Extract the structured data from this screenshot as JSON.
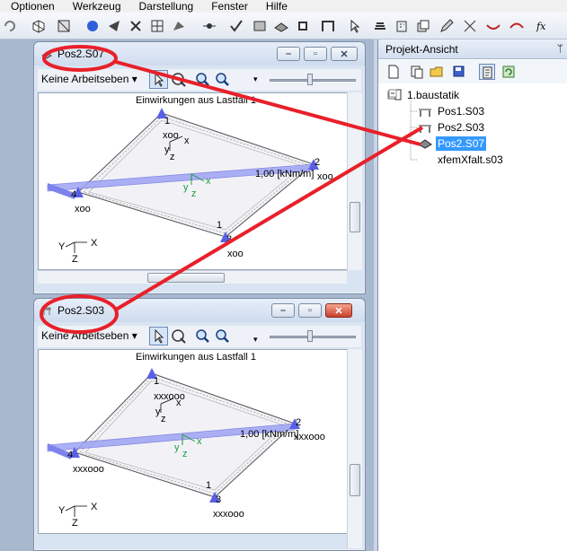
{
  "menu": {
    "items": [
      "Optionen",
      "Werkzeug",
      "Darstellung",
      "Fenster",
      "Hilfe"
    ]
  },
  "windows": [
    {
      "title": "Pos2.S07",
      "ebene_label": "Keine Arbeitseben",
      "view_title": "Einwirkungen aus Lastfall 1",
      "load_label": "1,00 [kNm/m]",
      "node_labels": {
        "top": "xoo",
        "right": "xoo",
        "left": "xoo",
        "bottom": "xoo"
      },
      "node_numbers": {
        "top": "1",
        "right": "2",
        "left": "4",
        "bottom": "1",
        "bottom2": "3"
      },
      "active": false
    },
    {
      "title": "Pos2.S03",
      "ebene_label": "Keine Arbeitseben",
      "view_title": "Einwirkungen aus Lastfall 1",
      "load_label": "1,00 [kNm/m]",
      "node_labels": {
        "top": "xxxooo",
        "right": "xxxooo",
        "left": "xxxooo",
        "bottom": "xxxooo"
      },
      "node_numbers": {
        "top": "1",
        "right": "2",
        "left": "4",
        "bottom": "1",
        "bottom2": "3"
      },
      "active": true
    }
  ],
  "axes": {
    "x": "x",
    "y": "y",
    "z": "z",
    "X": "X",
    "Y": "Y",
    "Z": "Z"
  },
  "panel": {
    "title": "Projekt-Ansicht",
    "pin": "॰",
    "tree": [
      {
        "label": "1.baustatik",
        "icon": "project-icon",
        "level": 0,
        "selected": false
      },
      {
        "label": "Pos1.S03",
        "icon": "table-icon",
        "level": 1,
        "selected": false
      },
      {
        "label": "Pos2.S03",
        "icon": "table-icon",
        "level": 1,
        "selected": false
      },
      {
        "label": "Pos2.S07",
        "icon": "slab-icon",
        "level": 1,
        "selected": true
      },
      {
        "label": "xfemXfalt.s03",
        "icon": "none",
        "level": 1,
        "selected": false
      }
    ]
  },
  "colors": {
    "annotation": "#e8202a",
    "load": "#8a8ff0",
    "support": "#5a5fe6",
    "selection": "#3399ff"
  }
}
